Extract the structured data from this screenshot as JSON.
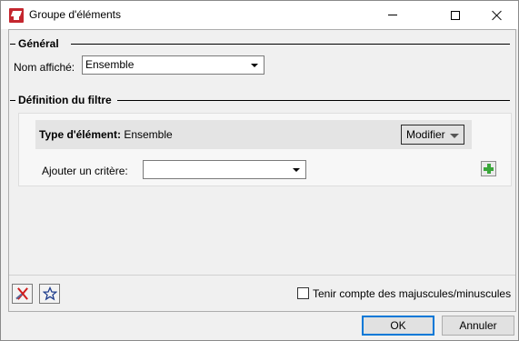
{
  "window": {
    "title": "Groupe d'éléments",
    "icon": "app-icon",
    "controls": [
      "minimize",
      "maximize",
      "close"
    ]
  },
  "general": {
    "heading": "Général",
    "display_name_label": "Nom affiché:",
    "display_name_value": "Ensemble"
  },
  "filter": {
    "heading": "Définition du filtre",
    "element_type_label": "Type d'élément:",
    "element_type_value": "Ensemble",
    "modify_button": "Modifier",
    "add_criterion_label": "Ajouter un critère:",
    "add_criterion_value": ""
  },
  "footer": {
    "case_sensitive_label": "Tenir compte des majuscules/minuscules",
    "case_sensitive_checked": false
  },
  "buttons": {
    "ok": "OK",
    "cancel": "Annuler"
  }
}
